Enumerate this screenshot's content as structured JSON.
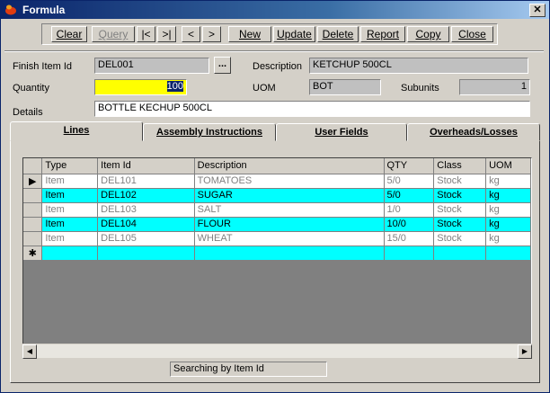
{
  "window": {
    "title": "Formula",
    "close_label": "✕"
  },
  "toolbar": {
    "buttons": [
      {
        "label": "Clear"
      },
      {
        "label": "Query"
      },
      {
        "label": "|<"
      },
      {
        "label": ">|"
      },
      {
        "label": "<"
      },
      {
        "label": ">"
      },
      {
        "label": "New"
      },
      {
        "label": "Update"
      },
      {
        "label": "Delete"
      },
      {
        "label": "Report"
      },
      {
        "label": "Copy"
      },
      {
        "label": "Close"
      }
    ]
  },
  "form": {
    "finish_item_id_label": "Finish Item Id",
    "finish_item_id_value": "DEL001",
    "lookup_button": "...",
    "description_label": "Description",
    "description_value": "KETCHUP 500CL",
    "quantity_label": "Quantity",
    "quantity_value": "100",
    "uom_label": "UOM",
    "uom_value": "BOT",
    "subunits_label": "Subunits",
    "subunits_value": "1",
    "details_label": "Details",
    "details_value": "BOTTLE KECHUP 500CL"
  },
  "tabs": [
    {
      "label": "Lines"
    },
    {
      "label": "Assembly Instructions"
    },
    {
      "label": "User Fields"
    },
    {
      "label": "Overheads/Losses"
    }
  ],
  "grid": {
    "columns": [
      "Type",
      "Item Id",
      "Description",
      "QTY",
      "Class",
      "UOM"
    ],
    "rows": [
      {
        "indicator": "▶",
        "type": "Item",
        "item_id": "DEL101",
        "description": "TOMATOES",
        "qty": "5/0",
        "class": "Stock",
        "uom": "kg"
      },
      {
        "indicator": "",
        "type": "Item",
        "item_id": "DEL102",
        "description": "SUGAR",
        "qty": "5/0",
        "class": "Stock",
        "uom": "kg"
      },
      {
        "indicator": "",
        "type": "Item",
        "item_id": "DEL103",
        "description": "SALT",
        "qty": "1/0",
        "class": "Stock",
        "uom": "kg"
      },
      {
        "indicator": "",
        "type": "Item",
        "item_id": "DEL104",
        "description": "FLOUR",
        "qty": "10/0",
        "class": "Stock",
        "uom": "kg"
      },
      {
        "indicator": "",
        "type": "Item",
        "item_id": "DEL105",
        "description": "WHEAT",
        "qty": "15/0",
        "class": "Stock",
        "uom": "kg"
      },
      {
        "indicator": "✱",
        "type": "",
        "item_id": "",
        "description": "",
        "qty": "",
        "class": "",
        "uom": ""
      }
    ]
  },
  "scrollbar": {
    "left_arrow": "◀",
    "right_arrow": "▶"
  },
  "status": {
    "text": "Searching by Item Id"
  },
  "colors": {
    "title_bar": "#0a246a",
    "highlight_row": "#00ffff",
    "quantity_field": "#ffff00",
    "window_bg": "#d4d0c8"
  }
}
